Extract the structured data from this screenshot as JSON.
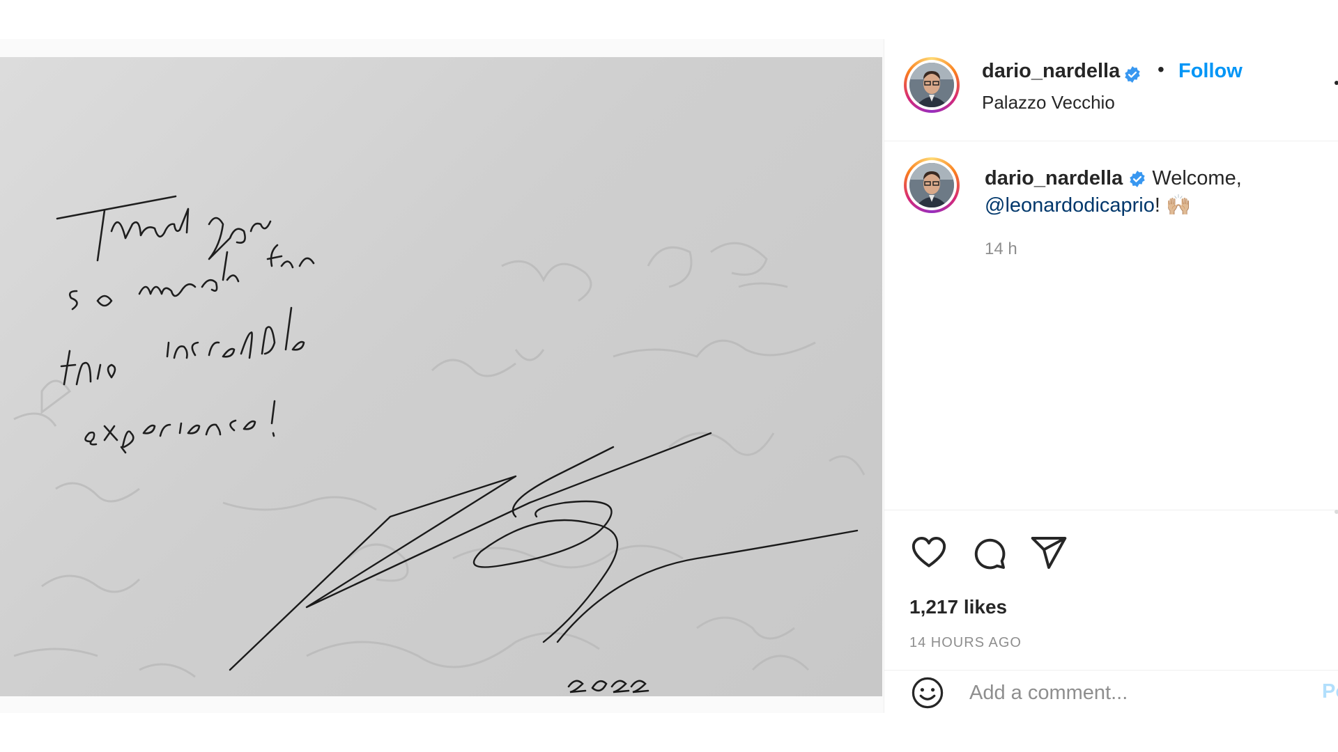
{
  "post": {
    "author": "dario_nardella",
    "follow_label": "Follow",
    "separator": "•",
    "location": "Palazzo Vecchio",
    "caption_text": "Welcome,",
    "caption_mention": "@leonardodicaprio",
    "caption_suffix": "!",
    "caption_emoji": "🙌🏼",
    "caption_time": "14 h",
    "likes": "1,217 likes",
    "time_ago": "14 HOURS AGO",
    "comment_placeholder": "Add a comment...",
    "post_label": "Po"
  },
  "photo": {
    "handwriting": "Thank you so much for this incredible experience!",
    "year": "2022"
  },
  "colors": {
    "accent": "#0095f6",
    "verified": "#3897f0",
    "mention": "#00376b"
  },
  "icons": [
    "verified-badge-icon",
    "heart-icon",
    "comment-icon",
    "share-icon",
    "emoji-icon"
  ]
}
